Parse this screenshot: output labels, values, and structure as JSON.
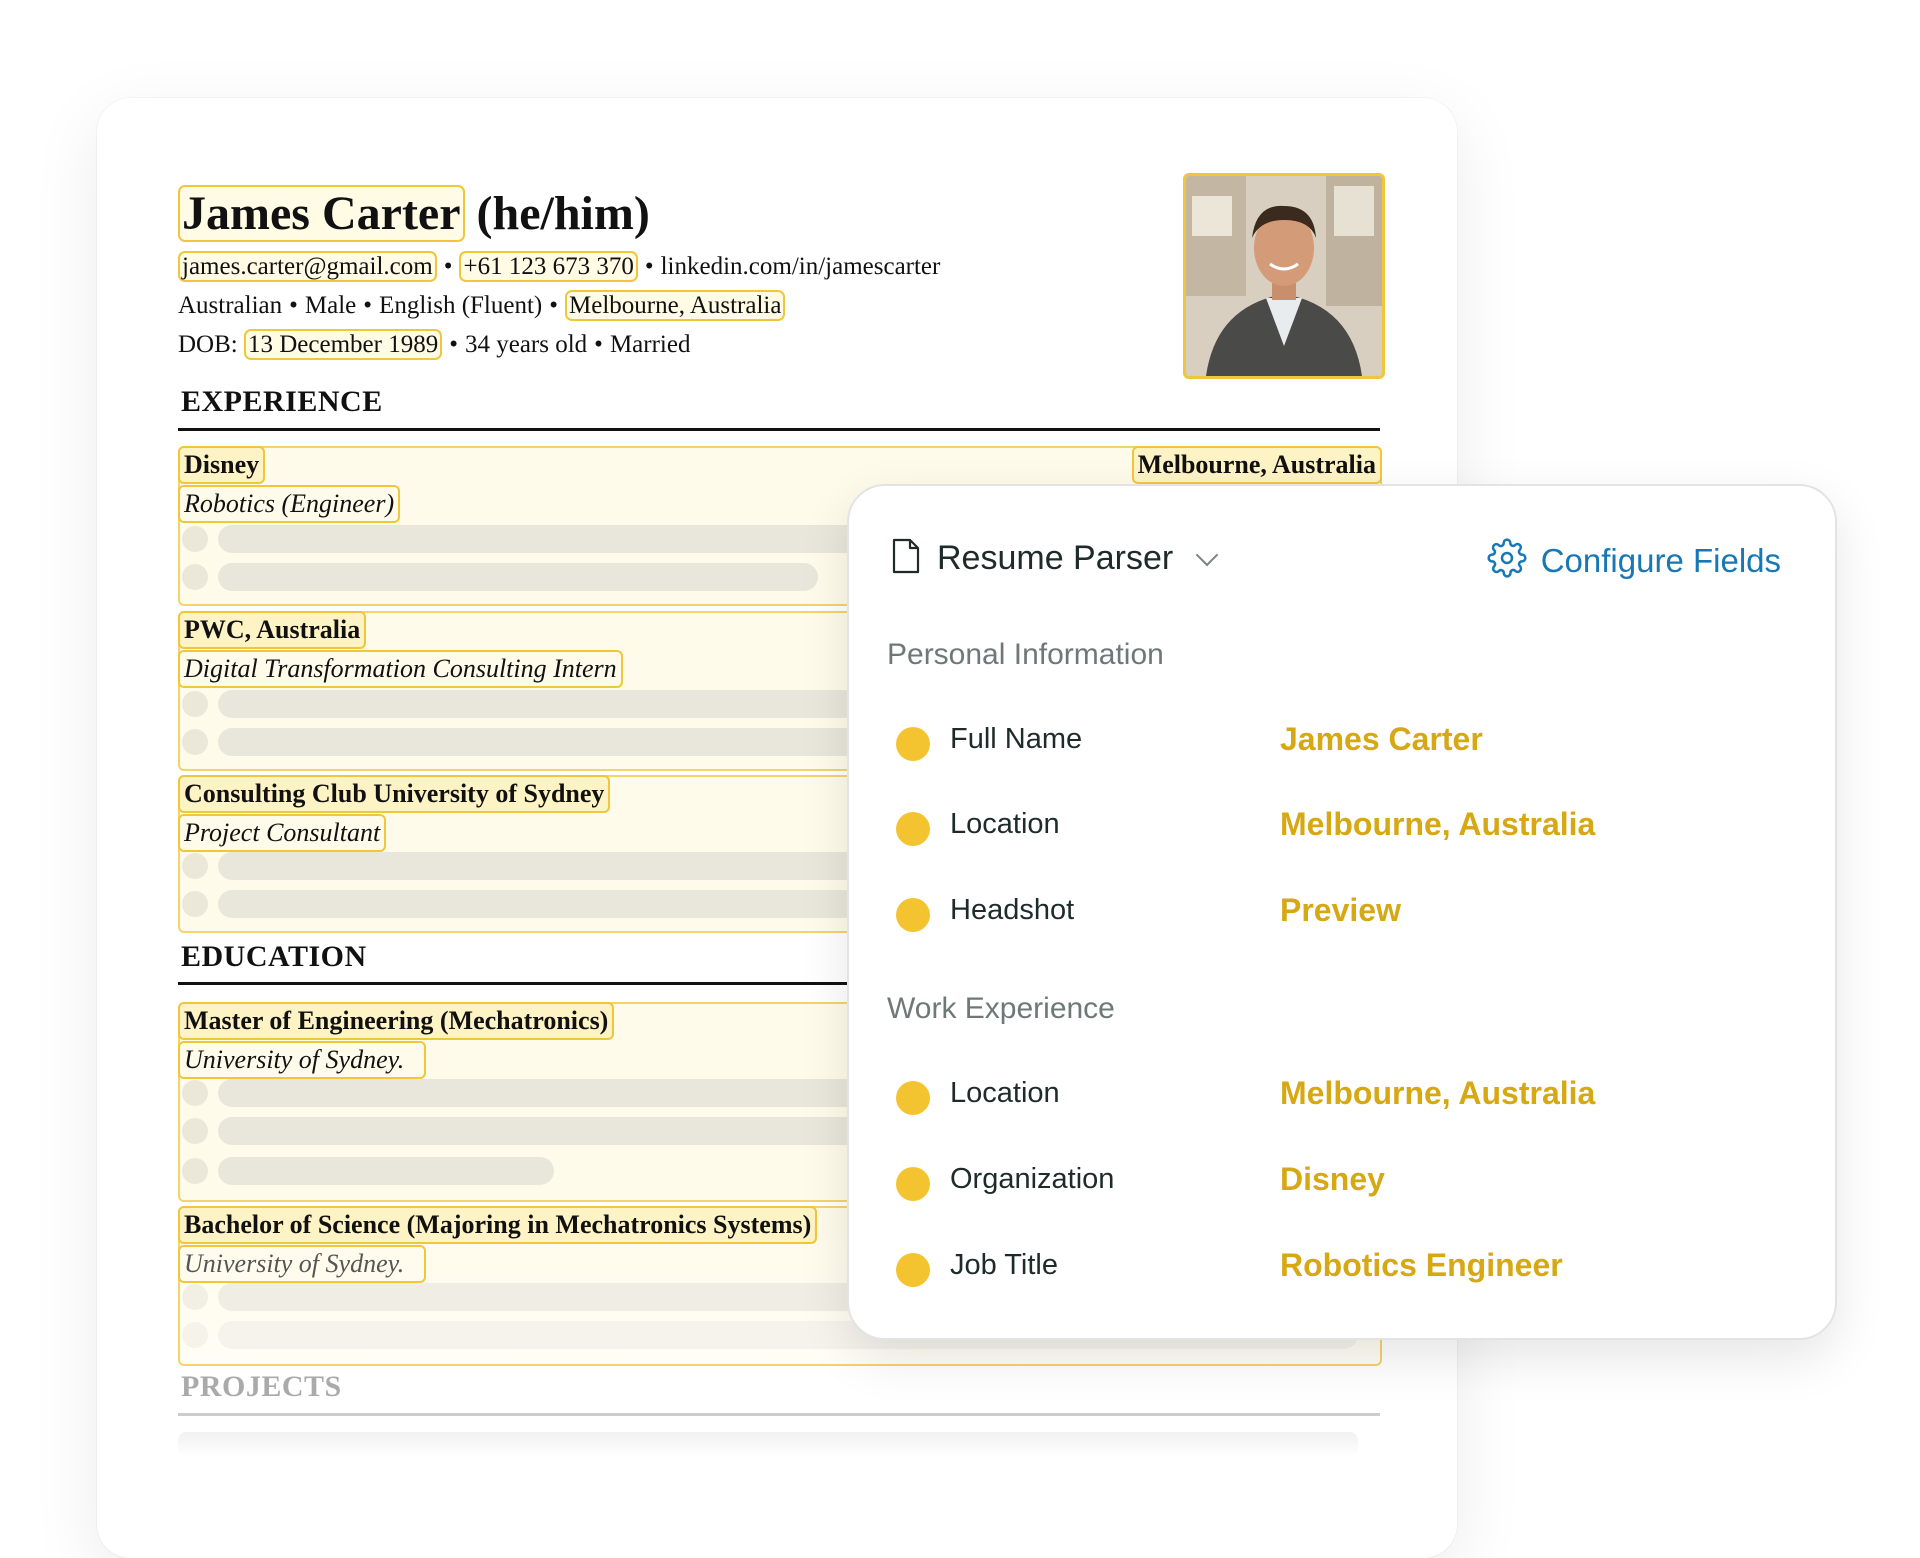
{
  "resume": {
    "name": "James Carter",
    "pronouns": "(he/him)",
    "email": "james.carter@gmail.com",
    "phone": "+61 123 673 370",
    "linkedin": "linkedin.com/in/jamescarter",
    "nationality": "Australian",
    "gender": "Male",
    "language": "English (Fluent)",
    "location": "Melbourne, Australia",
    "dob_label": "DOB:",
    "dob": "13 December 1989",
    "age": "34 years old",
    "marital": "Married",
    "bullet": "•",
    "sections": {
      "experience": "EXPERIENCE",
      "education": "EDUCATION",
      "projects": "PROJECTS"
    },
    "experience": [
      {
        "org": "Disney",
        "location": "Melbourne, Australia",
        "role": "Robotics (Engineer)"
      },
      {
        "org": "PWC, Australia",
        "location": "",
        "role": "Digital Transformation Consulting Intern"
      },
      {
        "org": "Consulting Club University of Sydney",
        "location": "",
        "role": "Project Consultant"
      }
    ],
    "education": [
      {
        "degree": "Master of Engineering (Mechatronics)",
        "school": "University of Sydney."
      },
      {
        "degree": "Bachelor of Science (Majoring in Mechatronics Systems)",
        "school": "University of Sydney."
      }
    ]
  },
  "parser": {
    "title": "Resume Parser",
    "configure_label": "Configure Fields",
    "groups": [
      {
        "label": "Personal Information",
        "fields": [
          {
            "label": "Full Name",
            "value": "James Carter"
          },
          {
            "label": "Location",
            "value": "Melbourne, Australia"
          },
          {
            "label": "Headshot",
            "value": "Preview"
          }
        ]
      },
      {
        "label": "Work Experience",
        "fields": [
          {
            "label": "Location",
            "value": "Melbourne, Australia"
          },
          {
            "label": "Organization",
            "value": "Disney"
          },
          {
            "label": "Job Title",
            "value": "Robotics Engineer"
          }
        ]
      }
    ],
    "colors": {
      "accent": "#d6a814",
      "dot": "#f4c430",
      "link": "#1778b5",
      "highlight": "#f0c63a"
    },
    "icons": {
      "title": "document-icon",
      "configure": "gear-icon",
      "dropdown": "chevron-down-icon"
    }
  }
}
